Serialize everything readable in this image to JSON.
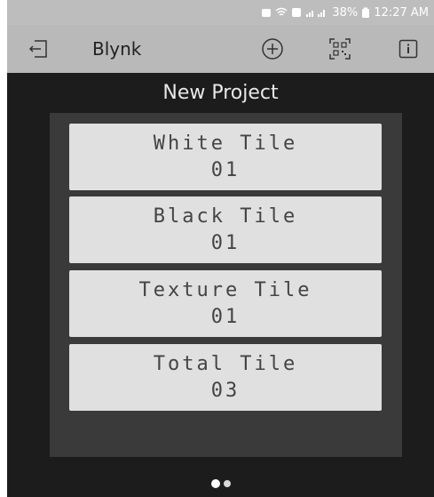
{
  "status_bar": {
    "battery": "38%",
    "time": "12:27 AM"
  },
  "app_bar": {
    "title": "Blynk",
    "icons": [
      "exit-icon",
      "add-circle-icon",
      "qr-code-icon",
      "info-icon"
    ]
  },
  "project": {
    "title": "New Project"
  },
  "tiles": [
    {
      "label": "White Tile",
      "value": "01"
    },
    {
      "label": "Black Tile",
      "value": "01"
    },
    {
      "label": "Texture Tile",
      "value": "01"
    },
    {
      "label": "Total Tile",
      "value": "03"
    }
  ],
  "pagination": {
    "pages": 2,
    "current": 1
  },
  "colors": {
    "status_bar": "#bdbdbd",
    "app_bar": "#b9b9b9",
    "background": "#1c1c1c",
    "canvas": "#3a3a3a",
    "tile": "#e0e0e0",
    "tile_text": "#444444"
  }
}
